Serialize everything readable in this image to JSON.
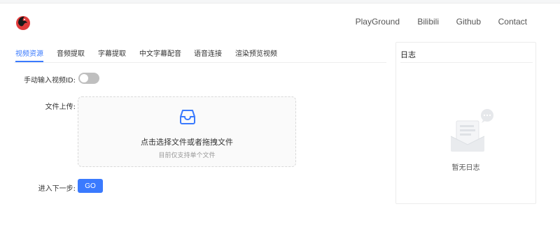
{
  "header": {
    "logo_icon": "app-logo-icon",
    "nav": [
      {
        "label": "PlayGround"
      },
      {
        "label": "Bilibili"
      },
      {
        "label": "Github"
      },
      {
        "label": "Contact"
      }
    ]
  },
  "tabs": [
    {
      "label": "视频资源",
      "active": true
    },
    {
      "label": "音频提取",
      "active": false
    },
    {
      "label": "字幕提取",
      "active": false
    },
    {
      "label": "中文字幕配音",
      "active": false
    },
    {
      "label": "语音连接",
      "active": false
    },
    {
      "label": "渲染预览视频",
      "active": false
    }
  ],
  "form": {
    "manual_id_label": "手动输入视频ID:",
    "manual_id_enabled": false,
    "upload_label": "文件上传:",
    "upload": {
      "icon": "inbox-icon",
      "text": "点击选择文件或者拖拽文件",
      "hint": "目前仅支持单个文件"
    },
    "next_label": "进入下一步:",
    "go_button": "GO"
  },
  "log": {
    "title": "日志",
    "empty_text": "暂无日志",
    "empty_icon": "empty-inbox-icon"
  },
  "colors": {
    "accent": "#3a7afe",
    "switch_off": "#bfbfbf"
  }
}
